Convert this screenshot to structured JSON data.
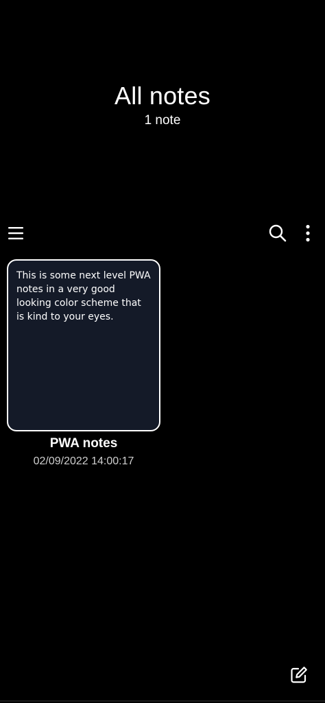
{
  "header": {
    "title": "All notes",
    "subtitle": "1 note"
  },
  "toolbar": {
    "menu_icon": "hamburger-menu-icon",
    "search_icon": "search-icon",
    "more_icon": "more-vertical-icon"
  },
  "notes": [
    {
      "preview": "This is some next level PWA notes in a very good looking color scheme that is kind to your eyes.",
      "title": "PWA notes",
      "date": "02/09/2022 14:00:17"
    }
  ],
  "fab": {
    "icon": "edit-note-icon"
  },
  "colors": {
    "background": "#000000",
    "card": "#141a28",
    "text": "#ffffff"
  }
}
